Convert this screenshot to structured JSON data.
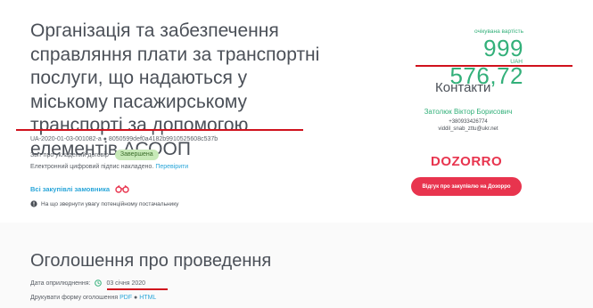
{
  "tender": {
    "title": "Організація та забезпечення справляння плати за транспортні послуги, що надаються у міському пасажирському транспорті за допомогою елементів АСООП",
    "id": "UA-2020-01-03-001082-a",
    "hash": "8050599def0a4182b9910525608c537b",
    "contract_report_label": "Звіт про укладений договір",
    "status": "Завершена",
    "signature_text": "Електронний цифровий підпис накладено.",
    "signature_link": "Перевірити",
    "all_purchases_link": "Всі закупівлі замовника",
    "warning_text": "На що звернути увагу потенційному постачальнику"
  },
  "price": {
    "label": "очікувана вартість",
    "value": "999 576,72",
    "currency": "UAH"
  },
  "contacts": {
    "title": "Контакти",
    "name": "Затолюк Віктор Борисович",
    "phone": "+380933426774",
    "email": "viddil_snab_zttu@ukr.net"
  },
  "dozorro": {
    "logo": "DOZORRO",
    "button_label": "Відгук про закупівлю на Дозорро"
  },
  "announcement": {
    "title": "Оголошення про проведення",
    "pub_date_label": "Дата оприлюднення:",
    "pub_date": "03 січня 2020",
    "print_label": "Друкувати форму оголошення",
    "print_pdf": "PDF",
    "print_html": "HTML"
  },
  "colors": {
    "accent_green": "#33b07a",
    "link_blue": "#2aa6d9",
    "dozorro_red": "#e8344e",
    "underline_red": "#d0121d",
    "badge_green": "#c7e9b8"
  },
  "icons": [
    "binoculars-icon",
    "alert-icon",
    "clock-icon"
  ]
}
